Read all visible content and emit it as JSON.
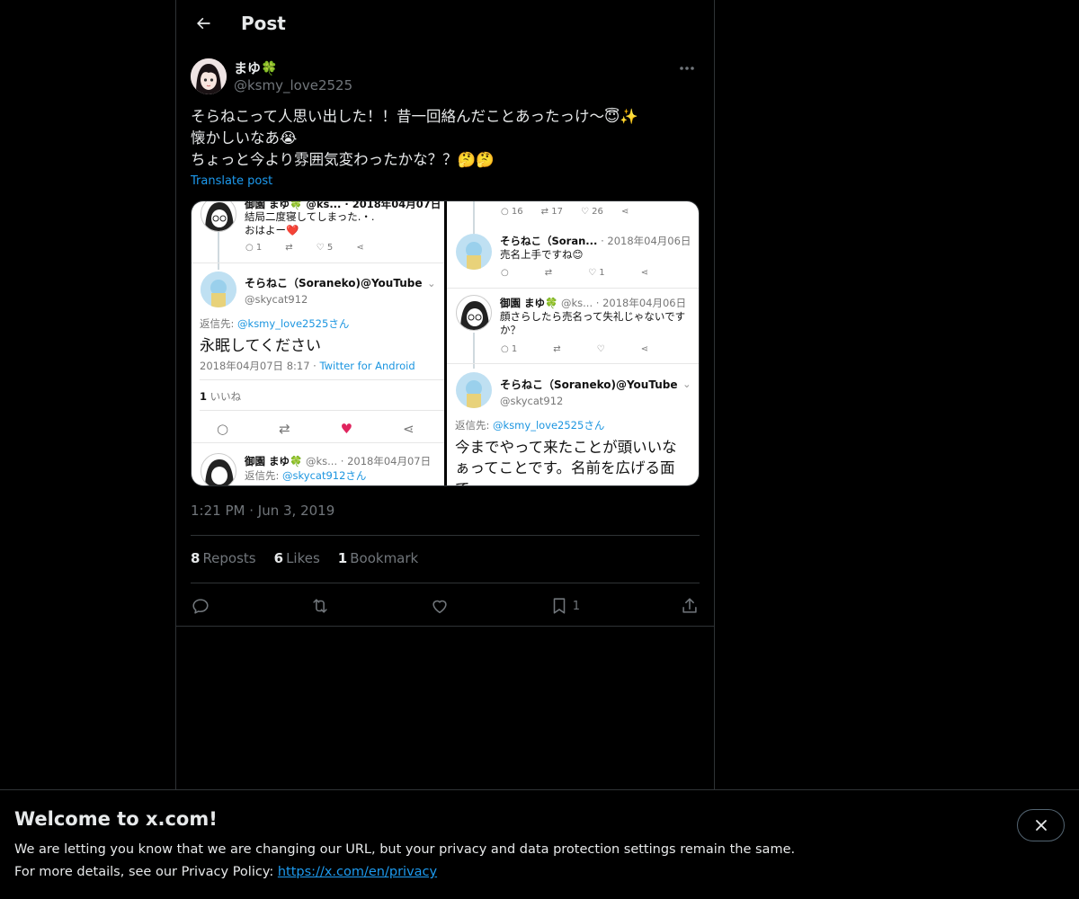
{
  "header": {
    "title": "Post"
  },
  "author": {
    "name": "まゆ🍀",
    "handle": "@ksmy_love2525"
  },
  "post": {
    "lines": [
      "そらねこって人思い出した！！昔一回絡んだことあったっけ〜😇✨",
      "懐かしいなあ😭",
      "ちょっと今より雰囲気変わったかな？？🤔🤔"
    ],
    "translate_label": "Translate post",
    "time": "1:21 PM",
    "separator": "·",
    "date": "Jun 3, 2019"
  },
  "media": {
    "left": {
      "top_header": "御園 まゆ🍀 @ks... · 2018年04月07日",
      "top_text_1": "結局二度寝してしまった.・.",
      "top_text_2": "おはよー❤️",
      "top_counts": [
        "1",
        "",
        "5"
      ],
      "main_name": "そらねこ（Soraneko)@YouTube",
      "main_handle": "@skycat912",
      "reply_prefix": "返信先: ",
      "reply_to": "@ksmy_love2525さん",
      "main_text": "永眠してください",
      "main_date": "2018年04月07日 8:17 · ",
      "main_client": "Twitter for Android",
      "likes_count": "1",
      "likes_label": "いいね",
      "bottom_header_name": "御園 まゆ🍀",
      "bottom_header_rest": "@ks... · 2018年04月07日",
      "bottom_reply_prefix": "返信先: ",
      "bottom_reply_to": "@skycat912さん"
    },
    "right": {
      "top_counts": [
        "16",
        "17",
        "26"
      ],
      "r1_name": "そらねこ（Soran...",
      "r1_date": "· 2018年04月06日",
      "r1_text": "売名上手ですね😊",
      "r1_counts": [
        "",
        "",
        "1"
      ],
      "r2_name": "御園 まゆ🍀",
      "r2_rest": "@ks... · 2018年04月06日",
      "r2_text_1": "顔さらしたら売名って失礼じゃないです",
      "r2_text_2": "か？",
      "r2_counts": [
        "1",
        "",
        ""
      ],
      "main_name": "そらねこ（Soraneko)@YouTube",
      "main_handle": "@skycat912",
      "reply_prefix": "返信先: ",
      "reply_to": "@ksmy_love2525さん",
      "main_text_1": "今までやって来たことが頭いいな",
      "main_text_2": "ぁってことです。名前を広げる面",
      "main_text_3": "で"
    }
  },
  "stats": {
    "reposts_count": "8",
    "reposts_label": "Reposts",
    "likes_count": "6",
    "likes_label": "Likes",
    "bookmarks_count": "1",
    "bookmarks_label": "Bookmark"
  },
  "actions": {
    "bookmark_count": "1"
  },
  "banner": {
    "title": "Welcome to x.com!",
    "line1": "We are letting you know that we are changing our URL, but your privacy and data protection settings remain the same.",
    "line2_prefix": "For more details, see our Privacy Policy: ",
    "link": "https://x.com/en/privacy"
  },
  "colors": {
    "accent": "#1d9bf0",
    "like_red": "#e0245e",
    "background": "#000000",
    "muted": "#71767b"
  },
  "icons": [
    "arrow-left-icon",
    "more-icon",
    "reply-icon",
    "repost-icon",
    "like-icon",
    "bookmark-icon",
    "share-icon",
    "close-icon"
  ]
}
